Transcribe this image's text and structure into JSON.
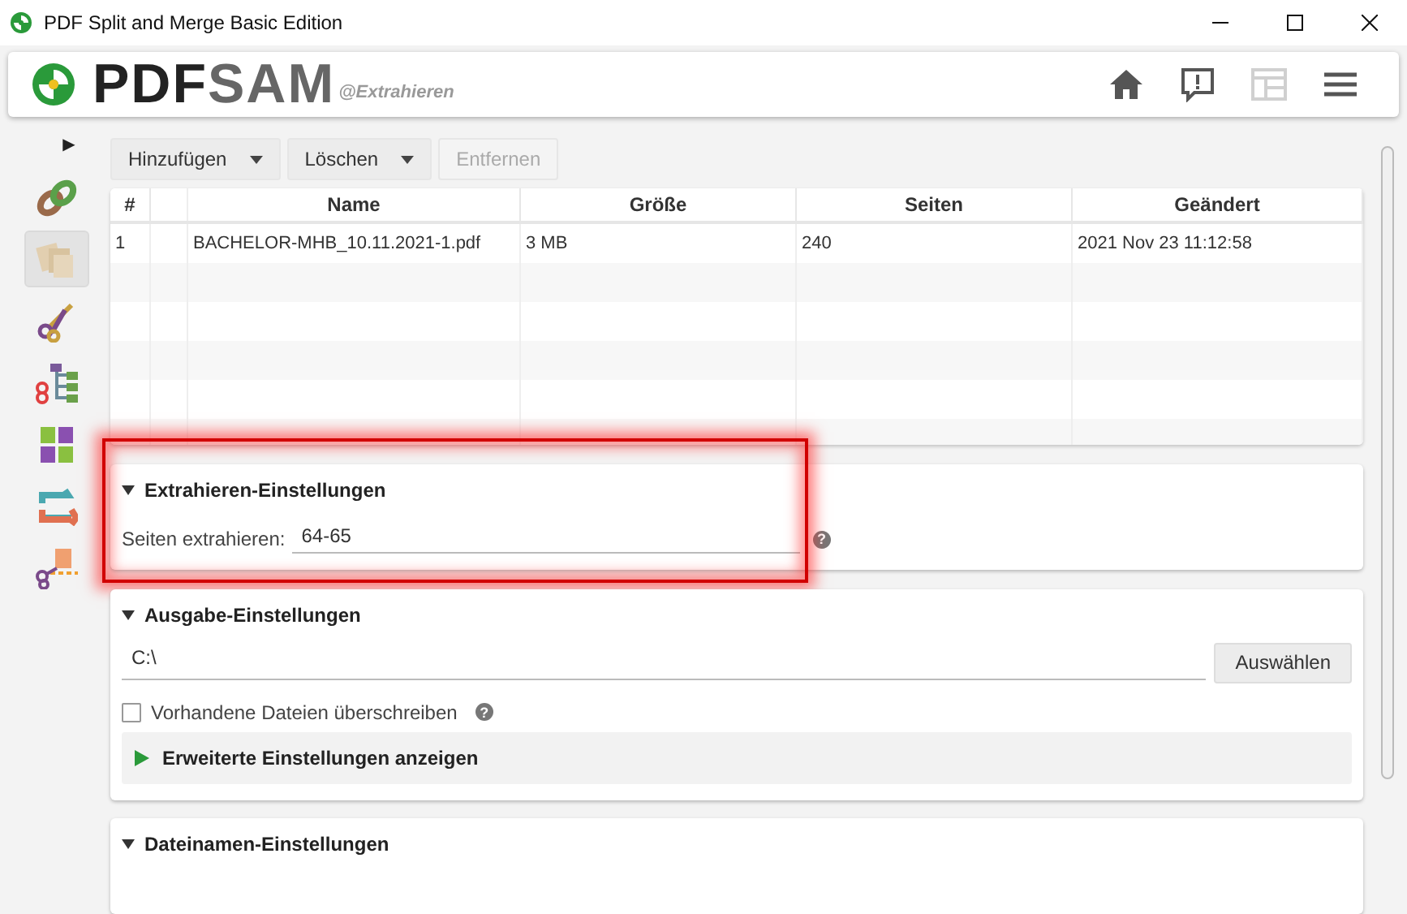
{
  "window": {
    "title": "PDF Split and Merge Basic Edition"
  },
  "header": {
    "logo_dark": "PDF",
    "logo_light": "SAM",
    "subtitle": "@Extrahieren",
    "icons": [
      {
        "kind": "home",
        "disabled": false
      },
      {
        "kind": "feedback",
        "disabled": false
      },
      {
        "kind": "layout",
        "disabled": true
      },
      {
        "kind": "menu",
        "disabled": false
      }
    ]
  },
  "sidebar": {
    "expand": "▶",
    "tools": [
      {
        "kind": "merge",
        "selected": false
      },
      {
        "kind": "extract",
        "selected": true
      },
      {
        "kind": "split",
        "selected": false
      },
      {
        "kind": "splitbookmarks",
        "selected": false
      },
      {
        "kind": "mix",
        "selected": false
      },
      {
        "kind": "rotate",
        "selected": false
      },
      {
        "kind": "splitsize",
        "selected": false
      }
    ]
  },
  "toolbar": [
    {
      "label": "Hinzufügen",
      "dropdown": true,
      "disabled": false
    },
    {
      "label": "Löschen",
      "dropdown": true,
      "disabled": false
    },
    {
      "label": "Entfernen",
      "dropdown": false,
      "disabled": true
    }
  ],
  "table": {
    "columns": [
      "#",
      "",
      "Name",
      "Größe",
      "Seiten",
      "Geändert"
    ],
    "rows": [
      [
        "1",
        "",
        "BACHELOR-MHB_10.11.2021-1.pdf",
        "3 MB",
        "240",
        "2021 Nov 23 11:12:58"
      ]
    ]
  },
  "extract": {
    "title": "Extrahieren-Einstellungen",
    "expanded": true,
    "label": "Seiten extrahieren:",
    "value": "64-65",
    "help": "?"
  },
  "output": {
    "title": "Ausgabe-Einstellungen",
    "expanded": true,
    "path": "C:\\",
    "button": "Auswählen",
    "overwrite": {
      "label": "Vorhandene Dateien überschreiben",
      "checked": false,
      "help": "?"
    },
    "advanced": {
      "label": "Erweiterte Einstellungen anzeigen",
      "expanded": false
    }
  },
  "filenames": {
    "title": "Dateinamen-Einstellungen",
    "expanded": true
  }
}
